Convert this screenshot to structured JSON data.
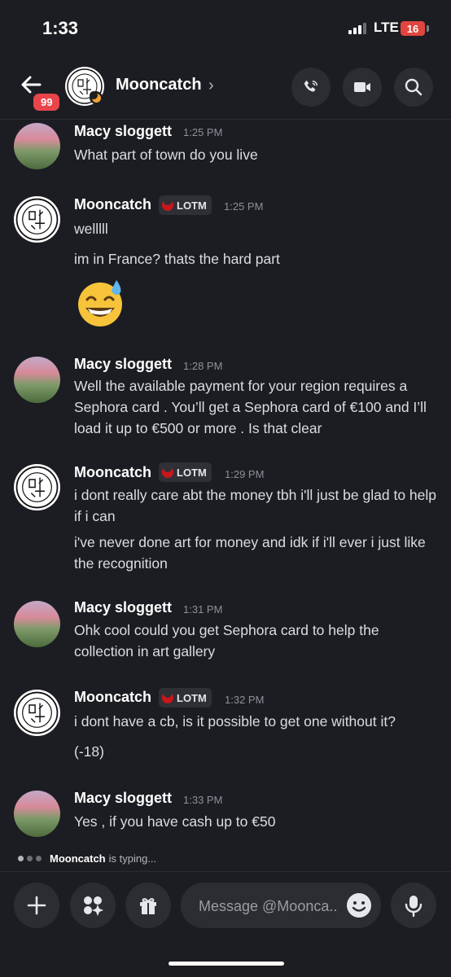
{
  "status": {
    "time": "1:33",
    "network": "LTE",
    "battery": "16"
  },
  "header": {
    "title": "Mooncatch",
    "badge": "99"
  },
  "colors": {
    "background": "#1c1d22",
    "badge": "#e8454b",
    "tag_icon": "#c9161b"
  },
  "messages": [
    {
      "author": "Macy sloggett",
      "time": "1:25 PM",
      "lines": [
        "What part of town do you live"
      ]
    },
    {
      "author": "Mooncatch",
      "tag": "LOTM",
      "time": "1:25 PM",
      "lines": [
        "welllll",
        "im in France? thats the hard part"
      ],
      "emoji": "grinning-face-with-sweat"
    },
    {
      "author": "Macy sloggett",
      "time": "1:28 PM",
      "lines": [
        "Well the available payment for your region requires a Sephora card . You’ll get a Sephora card of €100 and I’ll load it up to €500 or more . Is that clear"
      ]
    },
    {
      "author": "Mooncatch",
      "tag": "LOTM",
      "time": "1:29 PM",
      "lines": [
        "i dont really care abt the money tbh i'll just be glad to help if i can",
        "i've never done art for money and idk if i'll ever i just like the recognition"
      ]
    },
    {
      "author": "Macy sloggett",
      "time": "1:31 PM",
      "lines": [
        "Ohk cool could you get Sephora card to help the collection in art gallery"
      ]
    },
    {
      "author": "Mooncatch",
      "tag": "LOTM",
      "time": "1:32 PM",
      "lines": [
        "i dont have a cb, is it possible to get one without it?",
        "(-18)"
      ]
    },
    {
      "author": "Macy sloggett",
      "time": "1:33 PM",
      "lines": [
        "Yes , if you have cash up to €50"
      ]
    }
  ],
  "typing": {
    "user": "Mooncatch",
    "text": "is typing..."
  },
  "composer": {
    "placeholder": "Message @Moonca.."
  }
}
